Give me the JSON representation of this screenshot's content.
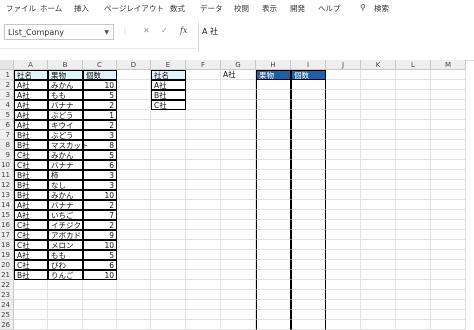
{
  "ribbon": {
    "tabs": [
      "ファイル",
      "ホーム",
      "挿入",
      "ページレイアウト",
      "数式",
      "データ",
      "校閲",
      "表示",
      "開発",
      "ヘルプ"
    ],
    "search_icon": "search-icon",
    "search_label": "検索"
  },
  "formula_bar": {
    "name_box": "List_Company",
    "cancel": "✕",
    "confirm": "✓",
    "fx": "fx",
    "formula": "A 社"
  },
  "sheet": {
    "columns": [
      "A",
      "B",
      "C",
      "D",
      "E",
      "F",
      "G",
      "H",
      "I",
      "J",
      "K",
      "L",
      "M"
    ],
    "rows": [
      "1",
      "2",
      "3",
      "4",
      "5",
      "6",
      "7",
      "8",
      "9",
      "10",
      "11",
      "12",
      "13",
      "14",
      "15",
      "16",
      "17",
      "18",
      "19",
      "20",
      "21",
      "22",
      "23",
      "24",
      "25",
      "26"
    ],
    "headers": {
      "company": "社名",
      "fruit": "果物",
      "count": "個数"
    },
    "data": [
      [
        "A社",
        "みかん",
        "10"
      ],
      [
        "A社",
        "もも",
        "5"
      ],
      [
        "A社",
        "バナナ",
        "2"
      ],
      [
        "A社",
        "ぶどう",
        "1"
      ],
      [
        "A社",
        "キウイ",
        "2"
      ],
      [
        "B社",
        "ぶどう",
        "3"
      ],
      [
        "B社",
        "マスカット",
        "8"
      ],
      [
        "C社",
        "みかん",
        "5"
      ],
      [
        "C社",
        "バナナ",
        "6"
      ],
      [
        "B社",
        "柿",
        "3"
      ],
      [
        "B社",
        "なし",
        "3"
      ],
      [
        "B社",
        "みかん",
        "10"
      ],
      [
        "A社",
        "バナナ",
        "2"
      ],
      [
        "A社",
        "いちご",
        "7"
      ],
      [
        "C社",
        "イチジク",
        "2"
      ],
      [
        "C社",
        "アボカド",
        "9"
      ],
      [
        "C社",
        "メロン",
        "10"
      ],
      [
        "A社",
        "もも",
        "5"
      ],
      [
        "C社",
        "びわ",
        "6"
      ],
      [
        "B社",
        "りんご",
        "10"
      ]
    ],
    "list": {
      "header": "社名",
      "items": [
        "A社",
        "B社",
        "C社"
      ]
    },
    "selected_company": "A社",
    "result_headers": {
      "fruit": "果物",
      "count": "個数"
    }
  },
  "colors": {
    "cyan_header": "#dff3fb",
    "blue_header": "#1f5fa6"
  }
}
